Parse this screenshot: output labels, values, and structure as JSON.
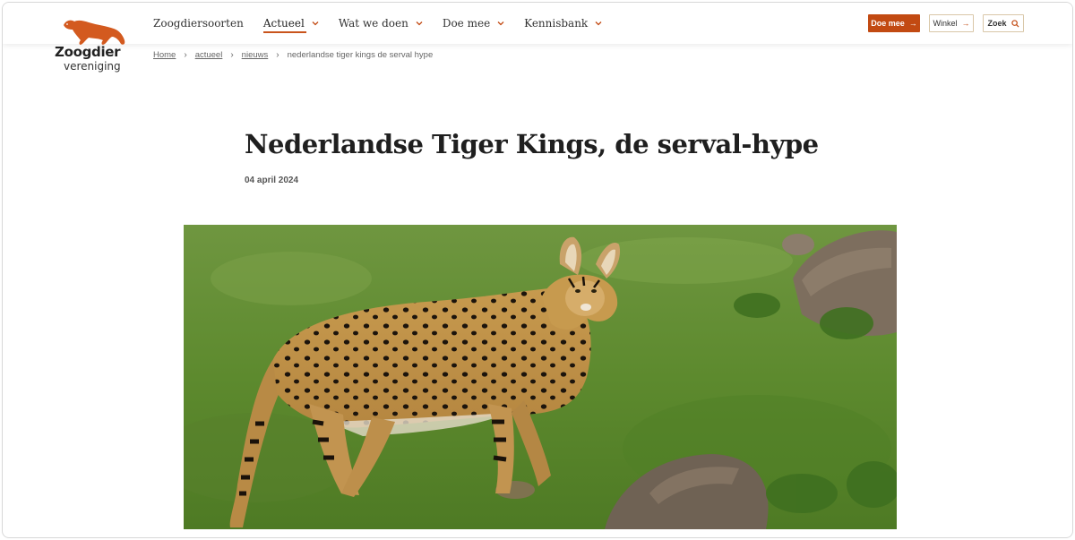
{
  "site": {
    "logo_word1": "Zoogdier",
    "logo_word2": "vereniging",
    "brand_color": "#c24a12"
  },
  "nav": {
    "items": [
      {
        "label": "Zoogdiersoorten",
        "has_dropdown": false,
        "active": false
      },
      {
        "label": "Actueel",
        "has_dropdown": true,
        "active": true
      },
      {
        "label": "Wat we doen",
        "has_dropdown": true,
        "active": false
      },
      {
        "label": "Doe mee",
        "has_dropdown": true,
        "active": false
      },
      {
        "label": "Kennisbank",
        "has_dropdown": true,
        "active": false
      }
    ]
  },
  "header_buttons": {
    "doe_mee": "Doe mee",
    "winkel": "Winkel",
    "zoek": "Zoek"
  },
  "breadcrumb": {
    "home": "Home",
    "actueel": "actueel",
    "nieuws": "nieuws",
    "current": "nederlandse tiger kings de serval hype"
  },
  "article": {
    "title": "Nederlandse Tiger Kings, de serval-hype",
    "date": "04 april 2024",
    "hero_image": "serval-photo"
  }
}
